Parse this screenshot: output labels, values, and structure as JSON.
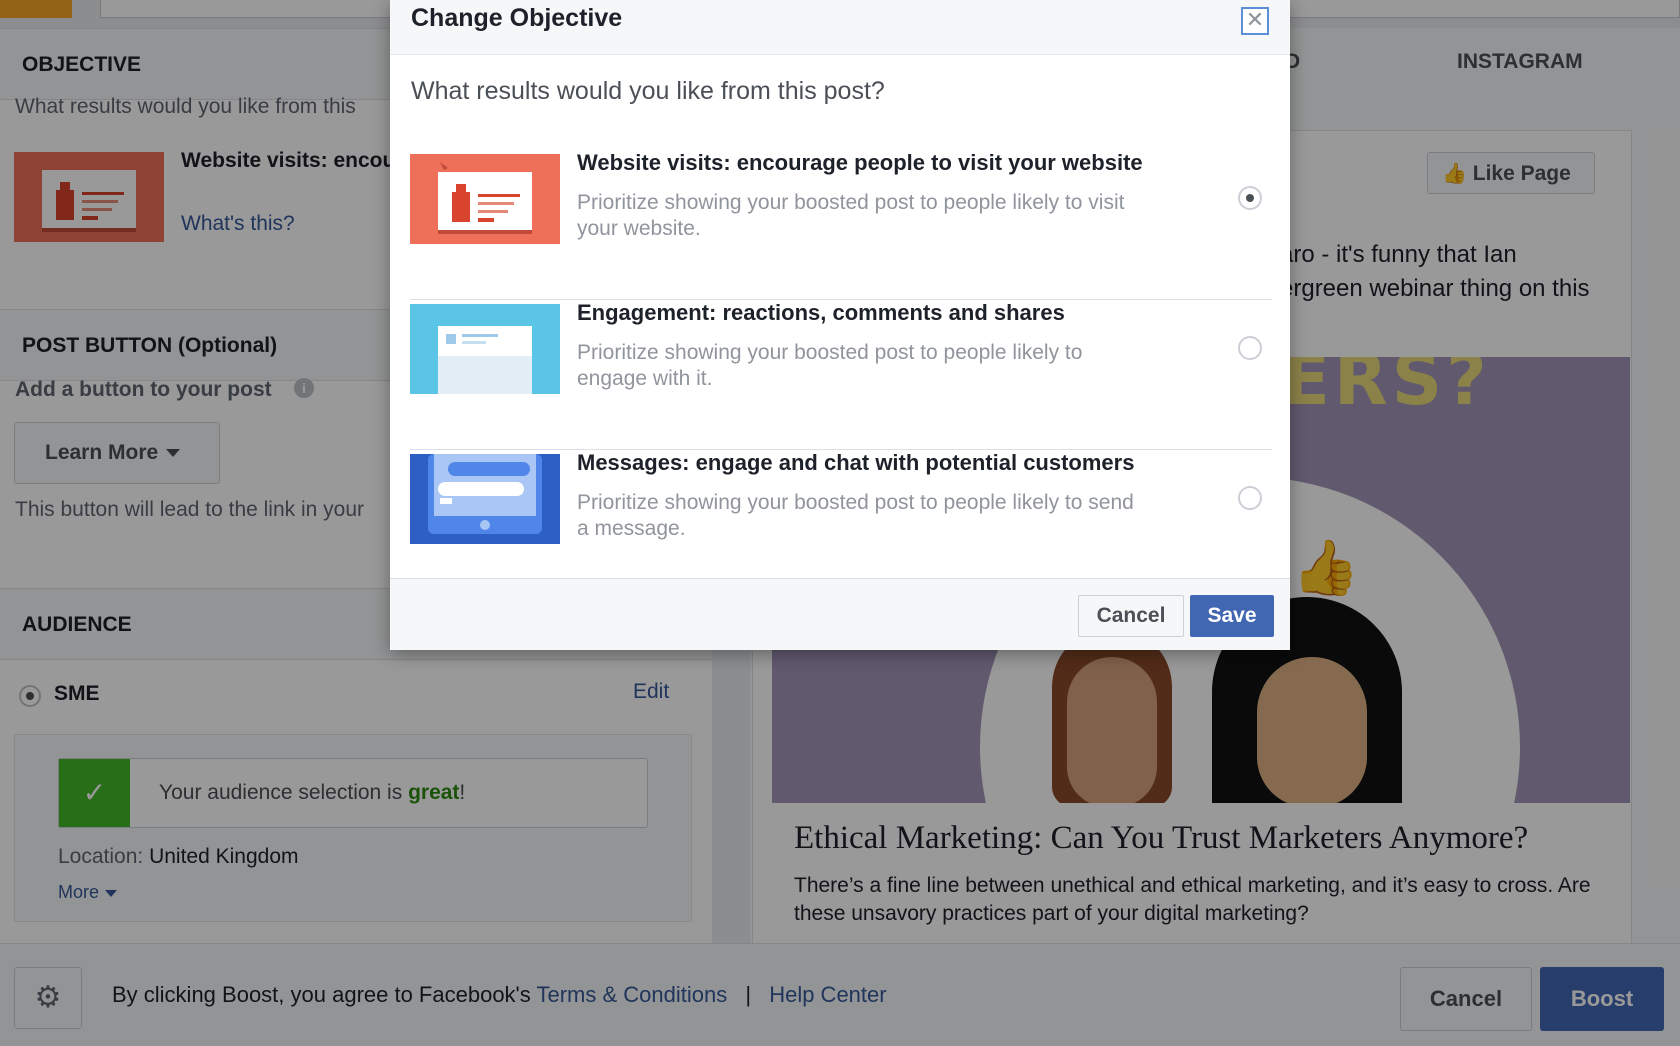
{
  "background": {
    "left_panel": {
      "objective_header": "OBJECTIVE",
      "objective_question": "What results would you like from this",
      "objective_title": "Website visits: encourage people to visit your website",
      "objective_link": "What's this?",
      "post_button_header": "POST BUTTON (Optional)",
      "add_button_label": "Add a button to your post",
      "info_glyph": "i",
      "learn_more_label": "Learn More",
      "button_hint": "This button will lead to the link in your",
      "audience_header": "AUDIENCE",
      "audience_name": "SME",
      "audience_edit": "Edit",
      "audience_status_prefix": "Your audience selection is ",
      "audience_status_emphasis": "great",
      "audience_status_suffix": "!",
      "location_label": "Location:",
      "location_value": "United Kingdom",
      "more_label": "More"
    },
    "right_panel": {
      "tab_partial": "D",
      "tab_instagram": "INSTAGRAM",
      "like_page_label": "Like Page",
      "post_text_line1": "aro - it's funny that Ian",
      "post_text_line2": "ergreen webinar thing on this",
      "image_text": "ERS?",
      "article_title": "Ethical Marketing: Can You Trust Marketers Anymore?",
      "article_desc": "There’s a fine line between unethical and ethical marketing, and it’s easy to cross. Are these unsavory practices part of your digital marketing?"
    },
    "footer": {
      "terms_prefix": "By clicking Boost, you agree to Facebook's",
      "terms_link": "Terms & Conditions",
      "separator": "|",
      "help_link": "Help Center",
      "cancel_label": "Cancel",
      "boost_label": "Boost"
    }
  },
  "modal": {
    "title": "Change Objective",
    "close_glyph": "✕",
    "question": "What results would you like from this post?",
    "options": [
      {
        "title": "Website visits: encourage people to visit your website",
        "description": "Prioritize showing your boosted post to people likely to visit your website.",
        "selected": true,
        "thumb_color": "#ee7058"
      },
      {
        "title": "Engagement: reactions, comments and shares",
        "description": "Prioritize showing your boosted post to people likely to engage with it.",
        "selected": false,
        "thumb_color": "#5bc5e8"
      },
      {
        "title": "Messages: engage and chat with potential customers",
        "description": "Prioritize showing your boosted post to people likely to send a message.",
        "selected": false,
        "thumb_color": "#2d5fc4"
      }
    ],
    "cancel_label": "Cancel",
    "save_label": "Save"
  },
  "colors": {
    "accent_blue": "#4267b2",
    "link_blue": "#365899",
    "success_green": "#42b72a",
    "orange_accent": "#f5a623"
  }
}
